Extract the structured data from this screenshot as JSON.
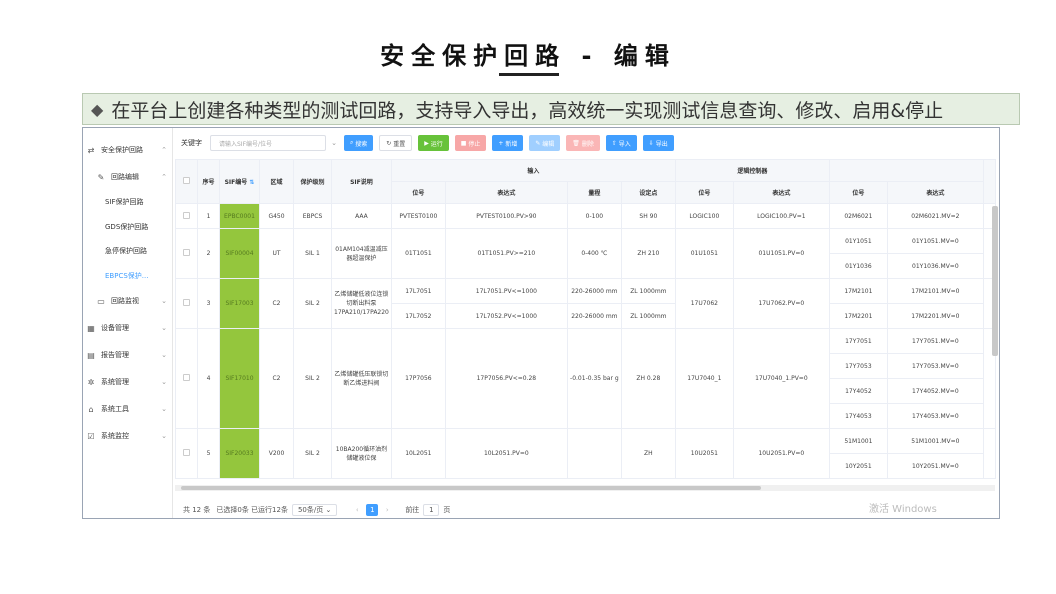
{
  "slide": {
    "title": "安全保护回路 - 编辑",
    "banner": "在平台上创建各种类型的测试回路，支持导入导出，高效统一实现测试信息查询、修改、启用&停止"
  },
  "sidebar": {
    "items": [
      {
        "label": "安全保护回路",
        "icon": "shield-icon"
      },
      {
        "label": "回路编辑",
        "icon": "edit-icon"
      },
      {
        "label": "SIF保护回路"
      },
      {
        "label": "GDS保护回路"
      },
      {
        "label": "急停保护回路"
      },
      {
        "label": "EBPCS保护..."
      },
      {
        "label": "回路监视",
        "icon": "monitor-icon"
      },
      {
        "label": "设备管理",
        "icon": "device-icon"
      },
      {
        "label": "报告管理",
        "icon": "report-icon"
      },
      {
        "label": "系统管理",
        "icon": "gear-icon"
      },
      {
        "label": "系统工具",
        "icon": "tool-icon"
      },
      {
        "label": "系统监控",
        "icon": "chart-icon"
      }
    ]
  },
  "toolbar": {
    "keyword_label": "关键字",
    "search_placeholder": "请输入SIF编号/位号",
    "buttons": [
      "搜索",
      "重置",
      "运行",
      "停止",
      "新增",
      "编辑",
      "删除",
      "导入",
      "导出"
    ]
  },
  "table": {
    "headers": {
      "seq": "序号",
      "sif_no": "SIF编号",
      "area": "区域",
      "level": "保护级别",
      "desc": "SIF说明",
      "input": "输入",
      "logic": "逻辑控制器",
      "tag": "位号",
      "expr": "表达式",
      "range": "量程",
      "setpoint": "设定点"
    },
    "rows": [
      {
        "seq": "1",
        "sif": "EPBC0001",
        "area": "G450",
        "level": "EBPCS",
        "desc": "AAA",
        "in": [
          [
            "PVTEST0100",
            "PVTEST0100.PV>90",
            "0-100",
            "SH 90"
          ]
        ],
        "lc": [
          "LOGIC100",
          "LOGIC100.PV=1"
        ],
        "out": [
          [
            "02M6021",
            "02M6021.MV=2"
          ]
        ]
      },
      {
        "seq": "2",
        "sif": "SIF00004",
        "area": "UT",
        "level": "SIL 1",
        "desc": "01AM104减温减压器超温保护",
        "in": [
          [
            "01T1051",
            "01T1051.PV>=210",
            "0-400 ℃",
            "ZH 210"
          ]
        ],
        "lc": [
          "01U1051",
          "01U1051.PV=0"
        ],
        "out": [
          [
            "01Y1051",
            "01Y1051.MV=0"
          ],
          [
            "01Y1036",
            "01Y1036.MV=0"
          ]
        ]
      },
      {
        "seq": "3",
        "sif": "SIF17003",
        "area": "C2",
        "level": "SIL 2",
        "desc": "乙烯储罐低液位连锁切断出料泵17PA210/17PA220",
        "in": [
          [
            "17L7051",
            "17L7051.PV<=1000",
            "220-26000 mm",
            "ZL 1000mm"
          ],
          [
            "17L7052",
            "17L7052.PV<=1000",
            "220-26000 mm",
            "ZL 1000mm"
          ]
        ],
        "lc": [
          "17U7062",
          "17U7062.PV=0"
        ],
        "out": [
          [
            "17M2101",
            "17M2101.MV=0"
          ],
          [
            "17M2201",
            "17M2201.MV=0"
          ]
        ]
      },
      {
        "seq": "4",
        "sif": "SIF17010",
        "area": "C2",
        "level": "SIL 2",
        "desc": "乙烯储罐低压联锁切断乙烯进料阀",
        "in": [
          [
            "17P7056",
            "17P7056.PV<=0.28",
            "-0.01-0.35 bar g",
            "ZH 0.28"
          ]
        ],
        "lc": [
          "17U7040_1",
          "17U7040_1.PV=0"
        ],
        "out": [
          [
            "17Y7051",
            "17Y7051.MV=0"
          ],
          [
            "17Y7053",
            "17Y7053.MV=0"
          ],
          [
            "17Y4052",
            "17Y4052.MV=0"
          ],
          [
            "17Y4053",
            "17Y4053.MV=0"
          ]
        ]
      },
      {
        "seq": "5",
        "sif": "SIF20033",
        "area": "V200",
        "level": "SIL 2",
        "desc": "10BA200循环油剂储罐液位保",
        "in": [
          [
            "10L2051",
            "10L2051.PV=0",
            "",
            "ZH"
          ]
        ],
        "lc": [
          "10U2051",
          "10U2051.PV=0"
        ],
        "out": [
          [
            "51M1001",
            "51M1001.MV=0"
          ],
          [
            "10Y2051",
            "10Y2051.MV=0"
          ]
        ]
      }
    ]
  },
  "footer": {
    "total": "共 12 条",
    "selected": "已选择0条 已运行12条",
    "page_size": "50条/页",
    "current_page": "1",
    "goto": "前往",
    "goto_page": "1",
    "page_unit": "页"
  },
  "watermark": "激活 Windows"
}
